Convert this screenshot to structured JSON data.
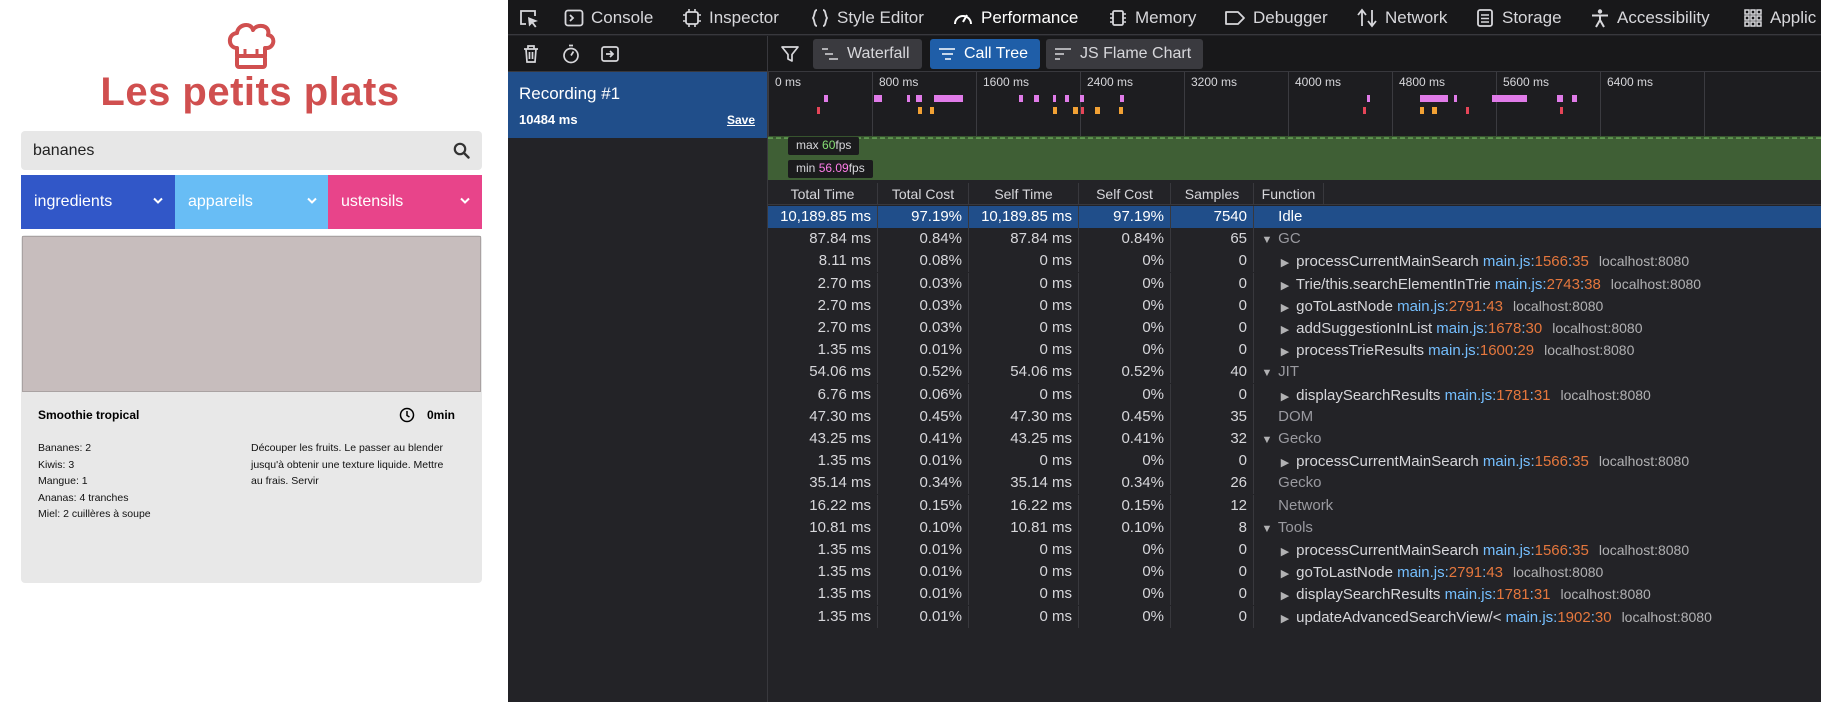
{
  "site": {
    "title": "Les petits plats",
    "search": {
      "value": "bananes",
      "placeholder": ""
    },
    "filters": [
      {
        "label": "ingredients",
        "color": "#3157c8"
      },
      {
        "label": "appareils",
        "color": "#68bdf5"
      },
      {
        "label": "ustensils",
        "color": "#e8448a"
      }
    ],
    "recipe": {
      "name": "Smoothie tropical",
      "time": "0min",
      "ingredients": [
        "Bananes: 2",
        "Kiwis: 3",
        "Mangue: 1",
        "Ananas: 4 tranches",
        "Miel: 2 cuillères à soupe"
      ],
      "instructions": "Découper les fruits. Le passer au blender jusqu'à obtenir une texture liquide. Mettre au frais. Servir"
    }
  },
  "devtools": {
    "tabs": [
      {
        "label": "",
        "icon": "pick-element-icon"
      },
      {
        "label": "Console",
        "icon": "console-icon"
      },
      {
        "label": "Inspector",
        "icon": "inspector-icon"
      },
      {
        "label": "Style Editor",
        "icon": "braces-icon"
      },
      {
        "label": "Performance",
        "icon": "gauge-icon",
        "active": true
      },
      {
        "label": "Memory",
        "icon": "chip-icon"
      },
      {
        "label": "Debugger",
        "icon": "tag-icon"
      },
      {
        "label": "Network",
        "icon": "arrows-icon"
      },
      {
        "label": "Storage",
        "icon": "storage-icon"
      },
      {
        "label": "Accessibility",
        "icon": "person-icon"
      },
      {
        "label": "Applic",
        "icon": "grid-icon"
      }
    ],
    "views": [
      {
        "label": "Waterfall",
        "active": false
      },
      {
        "label": "Call Tree",
        "active": true
      },
      {
        "label": "JS Flame Chart",
        "active": false
      }
    ],
    "recording": {
      "name": "Recording #1",
      "duration": "10484 ms",
      "save_label": "Save"
    },
    "timeline_ticks": [
      "0 ms",
      "800 ms",
      "1600 ms",
      "2400 ms",
      "3200 ms",
      "4000 ms",
      "4800 ms",
      "5600 ms",
      "6400 ms"
    ],
    "fps": {
      "max_label": "max",
      "max_value": "60",
      "min_label": "min",
      "min_value": "56.09",
      "unit": "fps"
    },
    "columns": [
      "Total Time",
      "Total Cost",
      "Self Time",
      "Self Cost",
      "Samples",
      "Function"
    ],
    "rows": [
      {
        "total_time": "10,189.85 ms",
        "total_cost": "97.19%",
        "self_time": "10,189.85 ms",
        "self_cost": "97.19%",
        "samples": "7540",
        "depth": 0,
        "twisty": "",
        "name": "Idle",
        "category": true,
        "file": "",
        "line": "",
        "col": "",
        "host": "",
        "selected": true
      },
      {
        "total_time": "87.84 ms",
        "total_cost": "0.84%",
        "self_time": "87.84 ms",
        "self_cost": "0.84%",
        "samples": "65",
        "depth": 0,
        "twisty": "▼",
        "name": "GC",
        "category": true,
        "file": "",
        "line": "",
        "col": "",
        "host": ""
      },
      {
        "total_time": "8.11 ms",
        "total_cost": "0.08%",
        "self_time": "0 ms",
        "self_cost": "0%",
        "samples": "0",
        "depth": 1,
        "twisty": "▶",
        "name": "processCurrentMainSearch",
        "file": "main.js",
        "line": "1566",
        "col": "35",
        "host": "localhost:8080"
      },
      {
        "total_time": "2.70 ms",
        "total_cost": "0.03%",
        "self_time": "0 ms",
        "self_cost": "0%",
        "samples": "0",
        "depth": 1,
        "twisty": "▶",
        "name": "Trie/this.searchElementInTrie",
        "file": "main.js",
        "line": "2743",
        "col": "38",
        "host": "localhost:8080"
      },
      {
        "total_time": "2.70 ms",
        "total_cost": "0.03%",
        "self_time": "0 ms",
        "self_cost": "0%",
        "samples": "0",
        "depth": 1,
        "twisty": "▶",
        "name": "goToLastNode",
        "file": "main.js",
        "line": "2791",
        "col": "43",
        "host": "localhost:8080"
      },
      {
        "total_time": "2.70 ms",
        "total_cost": "0.03%",
        "self_time": "0 ms",
        "self_cost": "0%",
        "samples": "0",
        "depth": 1,
        "twisty": "▶",
        "name": "addSuggestionInList",
        "file": "main.js",
        "line": "1678",
        "col": "30",
        "host": "localhost:8080"
      },
      {
        "total_time": "1.35 ms",
        "total_cost": "0.01%",
        "self_time": "0 ms",
        "self_cost": "0%",
        "samples": "0",
        "depth": 1,
        "twisty": "▶",
        "name": "processTrieResults",
        "file": "main.js",
        "line": "1600",
        "col": "29",
        "host": "localhost:8080"
      },
      {
        "total_time": "54.06 ms",
        "total_cost": "0.52%",
        "self_time": "54.06 ms",
        "self_cost": "0.52%",
        "samples": "40",
        "depth": 0,
        "twisty": "▼",
        "name": "JIT",
        "category": true,
        "file": "",
        "line": "",
        "col": "",
        "host": ""
      },
      {
        "total_time": "6.76 ms",
        "total_cost": "0.06%",
        "self_time": "0 ms",
        "self_cost": "0%",
        "samples": "0",
        "depth": 1,
        "twisty": "▶",
        "name": "displaySearchResults",
        "file": "main.js",
        "line": "1781",
        "col": "31",
        "host": "localhost:8080"
      },
      {
        "total_time": "47.30 ms",
        "total_cost": "0.45%",
        "self_time": "47.30 ms",
        "self_cost": "0.45%",
        "samples": "35",
        "depth": 0,
        "twisty": "",
        "name": "DOM",
        "category": true,
        "file": "",
        "line": "",
        "col": "",
        "host": ""
      },
      {
        "total_time": "43.25 ms",
        "total_cost": "0.41%",
        "self_time": "43.25 ms",
        "self_cost": "0.41%",
        "samples": "32",
        "depth": 0,
        "twisty": "▼",
        "name": "Gecko",
        "category": true,
        "file": "",
        "line": "",
        "col": "",
        "host": ""
      },
      {
        "total_time": "1.35 ms",
        "total_cost": "0.01%",
        "self_time": "0 ms",
        "self_cost": "0%",
        "samples": "0",
        "depth": 1,
        "twisty": "▶",
        "name": "processCurrentMainSearch",
        "file": "main.js",
        "line": "1566",
        "col": "35",
        "host": "localhost:8080"
      },
      {
        "total_time": "35.14 ms",
        "total_cost": "0.34%",
        "self_time": "35.14 ms",
        "self_cost": "0.34%",
        "samples": "26",
        "depth": 0,
        "twisty": "",
        "name": "Gecko",
        "category": true,
        "file": "",
        "line": "",
        "col": "",
        "host": ""
      },
      {
        "total_time": "16.22 ms",
        "total_cost": "0.15%",
        "self_time": "16.22 ms",
        "self_cost": "0.15%",
        "samples": "12",
        "depth": 0,
        "twisty": "",
        "name": "Network",
        "category": true,
        "file": "",
        "line": "",
        "col": "",
        "host": ""
      },
      {
        "total_time": "10.81 ms",
        "total_cost": "0.10%",
        "self_time": "10.81 ms",
        "self_cost": "0.10%",
        "samples": "8",
        "depth": 0,
        "twisty": "▼",
        "name": "Tools",
        "category": true,
        "file": "",
        "line": "",
        "col": "",
        "host": ""
      },
      {
        "total_time": "1.35 ms",
        "total_cost": "0.01%",
        "self_time": "0 ms",
        "self_cost": "0%",
        "samples": "0",
        "depth": 1,
        "twisty": "▶",
        "name": "processCurrentMainSearch",
        "file": "main.js",
        "line": "1566",
        "col": "35",
        "host": "localhost:8080"
      },
      {
        "total_time": "1.35 ms",
        "total_cost": "0.01%",
        "self_time": "0 ms",
        "self_cost": "0%",
        "samples": "0",
        "depth": 1,
        "twisty": "▶",
        "name": "goToLastNode",
        "file": "main.js",
        "line": "2791",
        "col": "43",
        "host": "localhost:8080"
      },
      {
        "total_time": "1.35 ms",
        "total_cost": "0.01%",
        "self_time": "0 ms",
        "self_cost": "0%",
        "samples": "0",
        "depth": 1,
        "twisty": "▶",
        "name": "displaySearchResults",
        "file": "main.js",
        "line": "1781",
        "col": "31",
        "host": "localhost:8080"
      },
      {
        "total_time": "1.35 ms",
        "total_cost": "0.01%",
        "self_time": "0 ms",
        "self_cost": "0%",
        "samples": "0",
        "depth": 1,
        "twisty": "▶",
        "name": "updateAdvancedSearchView/<",
        "file": "main.js",
        "line": "1902",
        "col": "30",
        "host": "localhost:8080"
      }
    ]
  }
}
